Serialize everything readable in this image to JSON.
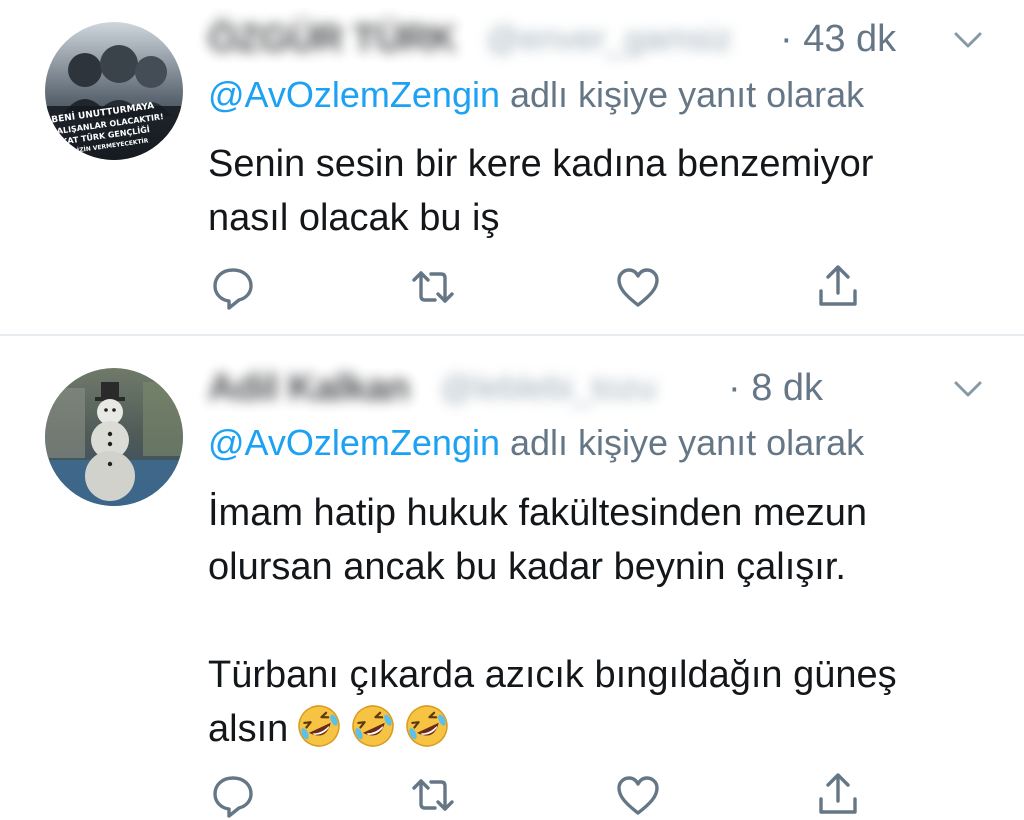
{
  "tweets": [
    {
      "name": "ÖZGÜR TÜRK",
      "handle": "@enver_gamsiz",
      "time": "· 43 dk",
      "reply_to": "@AvOzlemZengin",
      "reply_suffix": " adlı kişiye yanıt olarak",
      "text_lines": [
        "Senin sesin bir kere kadına benzemiyor",
        "nasıl olacak bu iş"
      ],
      "avatar_text": [
        "BENİ UNUTTURMAYA",
        "ÇALIŞANLAR OLACAKTIR!",
        "FAKAT TÜRK GENÇLİĞİ",
        "BUNA İZİN VERMEYECEKTİR"
      ]
    },
    {
      "name": "Adil Kalkan",
      "handle": "@leblebi_tozu",
      "time": "· 8 dk",
      "reply_to": "@AvOzlemZengin",
      "reply_suffix": " adlı kişiye yanıt olarak",
      "text_lines": [
        "İmam hatip hukuk fakültesinden mezun",
        "olursan ancak bu kadar beynin çalışır."
      ],
      "text_lines_2": [
        "Türbanı çıkarda azıcık bıngıldağın güneş",
        "alsın"
      ],
      "emoji": [
        "rofl-emoji",
        "rofl-emoji",
        "rofl-emoji"
      ]
    }
  ],
  "colors": {
    "primary_text": "#14171a",
    "secondary_text": "#657786",
    "icon": "#657786",
    "mention": "#1da1f2",
    "divider": "#e6ecf0",
    "emoji_face": "#f6c342"
  },
  "icons": [
    "reply-icon",
    "retweet-icon",
    "like-icon",
    "share-icon",
    "chevron-down-icon"
  ]
}
